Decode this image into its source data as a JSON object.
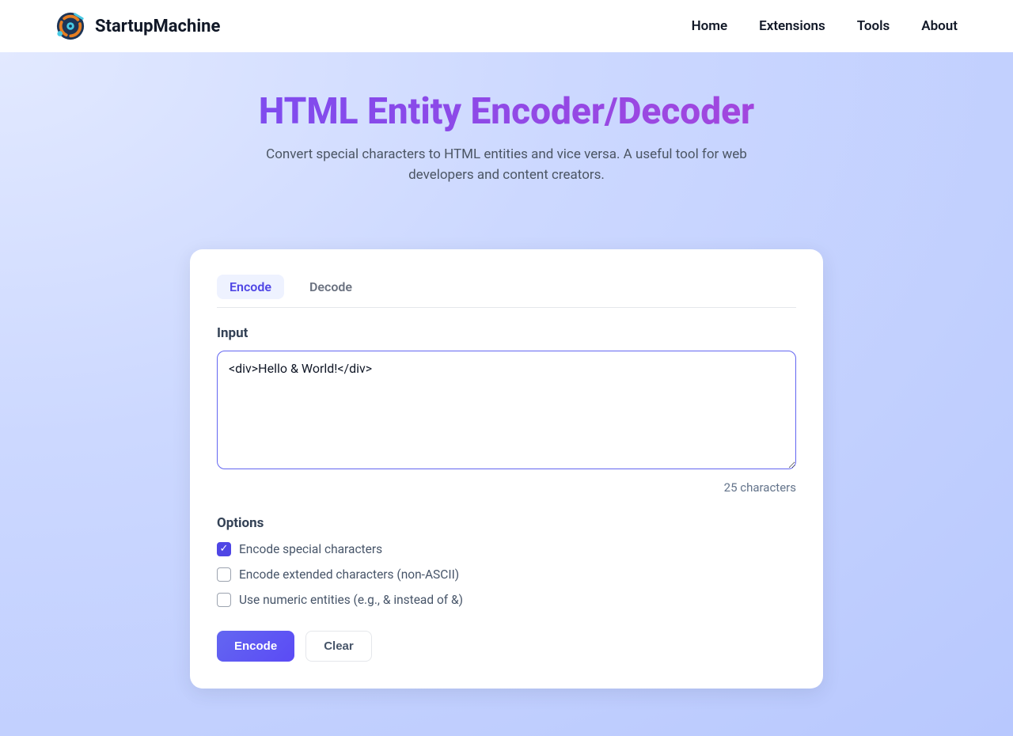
{
  "header": {
    "brand": "StartupMachine",
    "nav": [
      "Home",
      "Extensions",
      "Tools",
      "About"
    ]
  },
  "hero": {
    "title": "HTML Entity Encoder/Decoder",
    "subtitle": "Convert special characters to HTML entities and vice versa. A useful tool for web developers and content creators."
  },
  "tabs": {
    "encode": "Encode",
    "decode": "Decode",
    "active": "encode"
  },
  "input": {
    "label": "Input",
    "value": "<div>Hello & World!</div>",
    "char_count": "25 characters"
  },
  "options": {
    "title": "Options",
    "items": [
      {
        "label": "Encode special characters",
        "checked": true
      },
      {
        "label": "Encode extended characters (non-ASCII)",
        "checked": false
      },
      {
        "label": "Use numeric entities (e.g., & instead of &)",
        "checked": false
      }
    ]
  },
  "buttons": {
    "encode": "Encode",
    "clear": "Clear"
  }
}
